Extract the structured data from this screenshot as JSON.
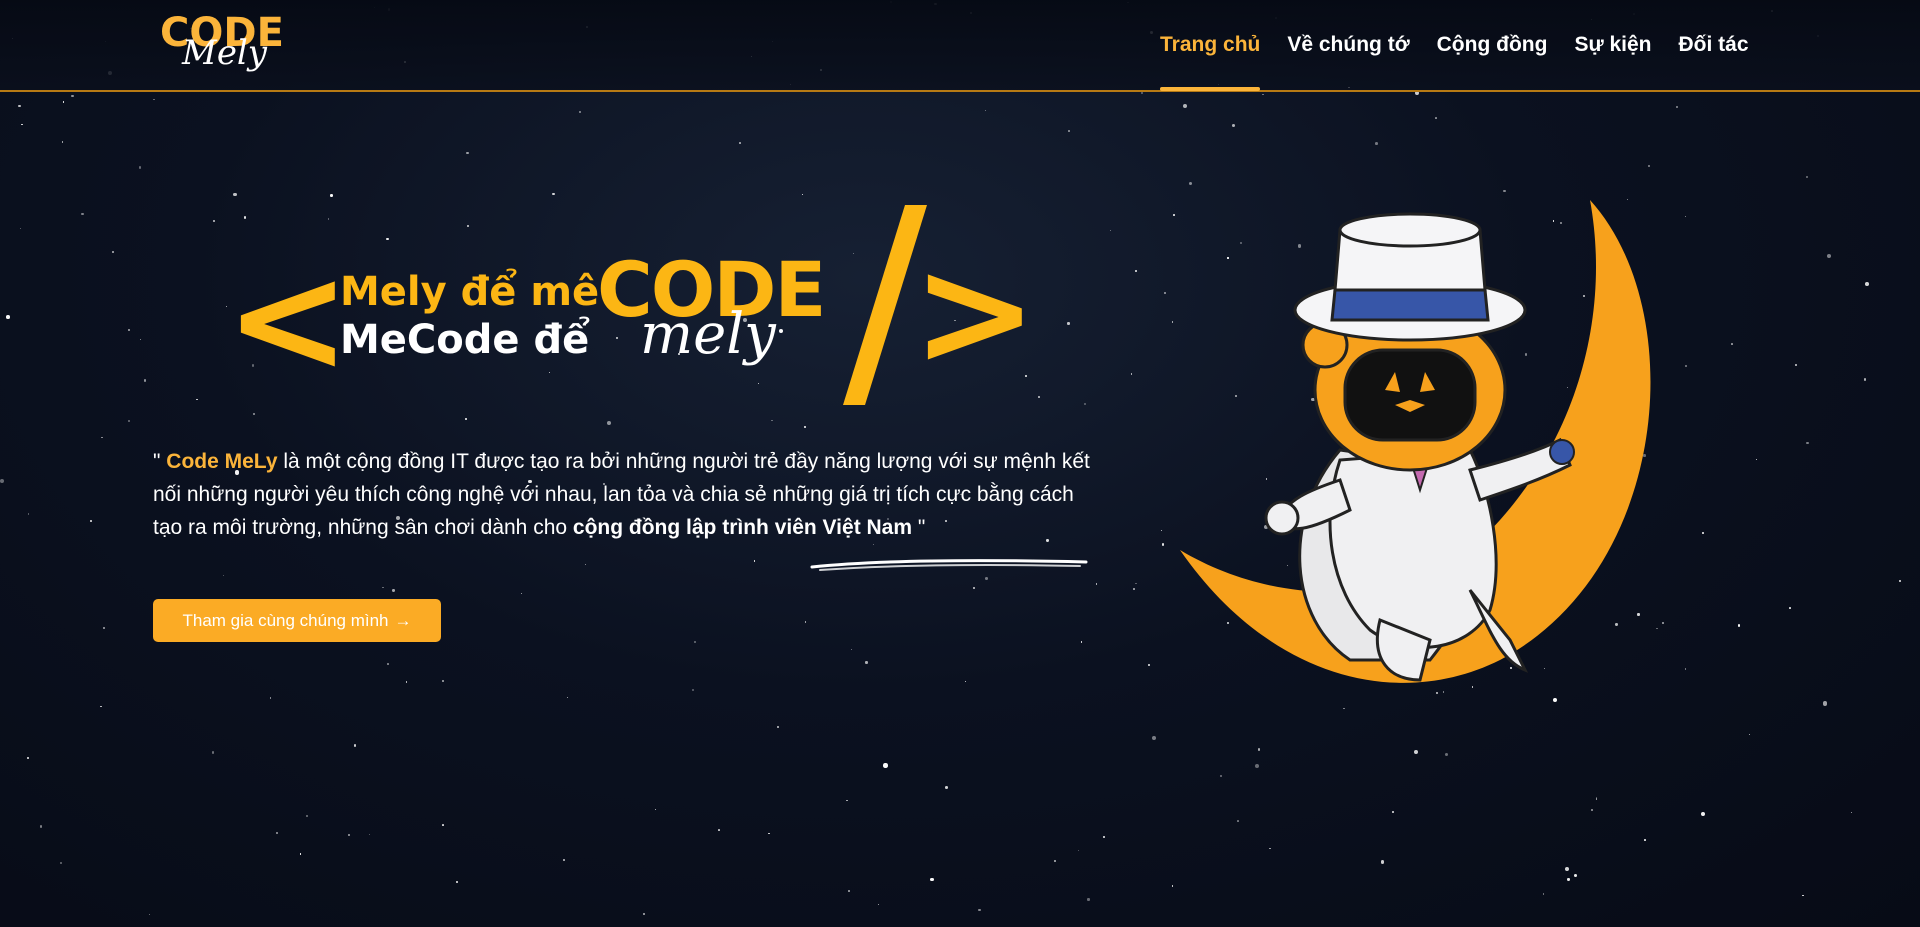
{
  "header": {
    "logo": {
      "main": "CODE",
      "script": "Mely"
    },
    "nav": [
      {
        "label": "Trang chủ",
        "active": true
      },
      {
        "label": "Về chúng tớ",
        "active": false
      },
      {
        "label": "Cộng đồng",
        "active": false
      },
      {
        "label": "Sự kiện",
        "active": false
      },
      {
        "label": "Đối tác",
        "active": false
      }
    ]
  },
  "hero": {
    "bracket_open": "<",
    "slogan_line1": "Mely để mê",
    "slogan_line2": "MeCode để",
    "big_code": "CODE",
    "big_script": "mely",
    "bracket_close": ">",
    "description": {
      "quote_open": "\" ",
      "brand": "Code MeLy",
      "text": " là một cộng đồng IT được tạo ra bởi những người trẻ đầy năng lượng với sự mệnh kết nối những người yêu thích công nghệ với nhau, lan tỏa và chia sẻ những giá trị tích cực bằng cách tạo ra môi trường, những sân chơi dành cho ",
      "bold": "cộng đồng lập trình viên Việt Nam",
      "quote_close": " \""
    },
    "cta_label": "Tham gia cùng chúng mình",
    "cta_icon": "arrow-right-icon"
  },
  "colors": {
    "accent": "#fbb43a",
    "brand_yellow": "#fcb614",
    "background": "#0b1120"
  }
}
